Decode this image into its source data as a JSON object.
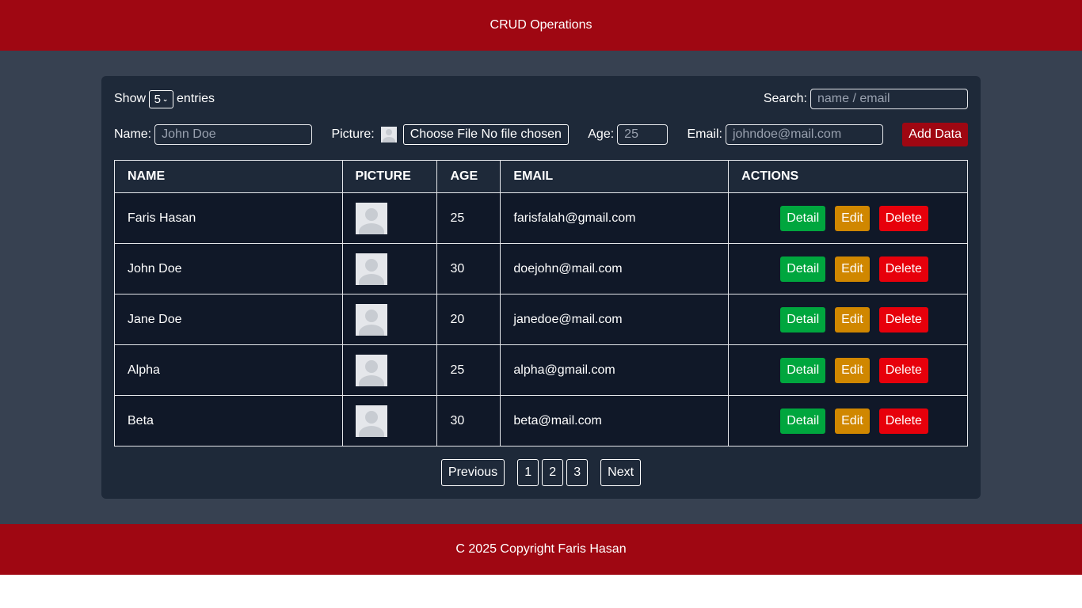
{
  "header": {
    "title": "CRUD Operations"
  },
  "controls": {
    "show_label": "Show",
    "entries_value": "5",
    "entries_label": "entries",
    "search_label": "Search:",
    "search_placeholder": "name / email"
  },
  "form": {
    "name_label": "Name:",
    "name_placeholder": "John Doe",
    "picture_label": "Picture:",
    "file_button": "Choose File No file chosen",
    "age_label": "Age:",
    "age_placeholder": "25",
    "email_label": "Email:",
    "email_placeholder": "johndoe@mail.com",
    "add_button": "Add Data"
  },
  "table": {
    "columns": [
      "NAME",
      "PICTURE",
      "AGE",
      "EMAIL",
      "ACTIONS"
    ],
    "rows": [
      {
        "name": "Faris Hasan",
        "age": "25",
        "email": "farisfalah@gmail.com"
      },
      {
        "name": "John Doe",
        "age": "30",
        "email": "doejohn@mail.com"
      },
      {
        "name": "Jane Doe",
        "age": "20",
        "email": "janedoe@mail.com"
      },
      {
        "name": "Alpha",
        "age": "25",
        "email": "alpha@gmail.com"
      },
      {
        "name": "Beta",
        "age": "30",
        "email": "beta@mail.com"
      }
    ],
    "actions": {
      "detail": "Detail",
      "edit": "Edit",
      "delete": "Delete"
    }
  },
  "pagination": {
    "previous": "Previous",
    "pages": [
      "1",
      "2",
      "3"
    ],
    "next": "Next"
  },
  "footer": {
    "text": "C 2025 Copyright Faris Hasan"
  },
  "colors": {
    "brand": "#9f0712",
    "detail": "#00a63e",
    "edit": "#d08700",
    "delete": "#e7000b"
  }
}
